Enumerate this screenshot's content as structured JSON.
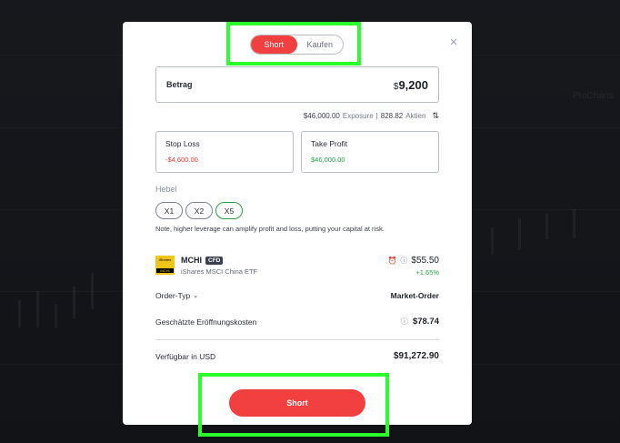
{
  "background": {
    "watermark": "ProCharts"
  },
  "modal": {
    "toggle": {
      "short_label": "Short",
      "buy_label": "Kaufen"
    },
    "close_icon": "close-icon",
    "amount": {
      "label": "Betrag",
      "currency": "$",
      "value": "9,200"
    },
    "exposure": {
      "value": "$46,000.00",
      "label": "Exposure",
      "separator": "|",
      "shares": "828.82",
      "shares_label": "Aktien",
      "swap_icon": "swap-icon"
    },
    "stop_loss": {
      "title": "Stop Loss",
      "value": "-$4,600.00"
    },
    "take_profit": {
      "title": "Take Profit",
      "value": "$46,000.00"
    },
    "leverage": {
      "label": "Hebel",
      "options": [
        "X1",
        "X2",
        "X5"
      ],
      "selected": "X5",
      "note": "Note, higher leverage can amplify profit and loss, putting your capital at risk."
    },
    "asset": {
      "logo_top": "iShares",
      "logo_bottom": "MCHI",
      "ticker": "MCHI",
      "badge": "CFD",
      "name": "iShares MSCI China ETF",
      "price": "$55.50",
      "change": "+1.65%"
    },
    "order_type": {
      "label": "Order-Typ",
      "value": "Market-Order"
    },
    "est_cost": {
      "label": "Geschätzte Eröffnungskosten",
      "value": "$78.74"
    },
    "available": {
      "label": "Verfügbar in USD",
      "value": "$91,272.90"
    },
    "submit": {
      "label": "Short"
    }
  },
  "colors": {
    "accent_red": "#f23f3f",
    "positive_green": "#24a148",
    "negative_red": "#e53935",
    "highlight_green": "#2bff2b"
  }
}
